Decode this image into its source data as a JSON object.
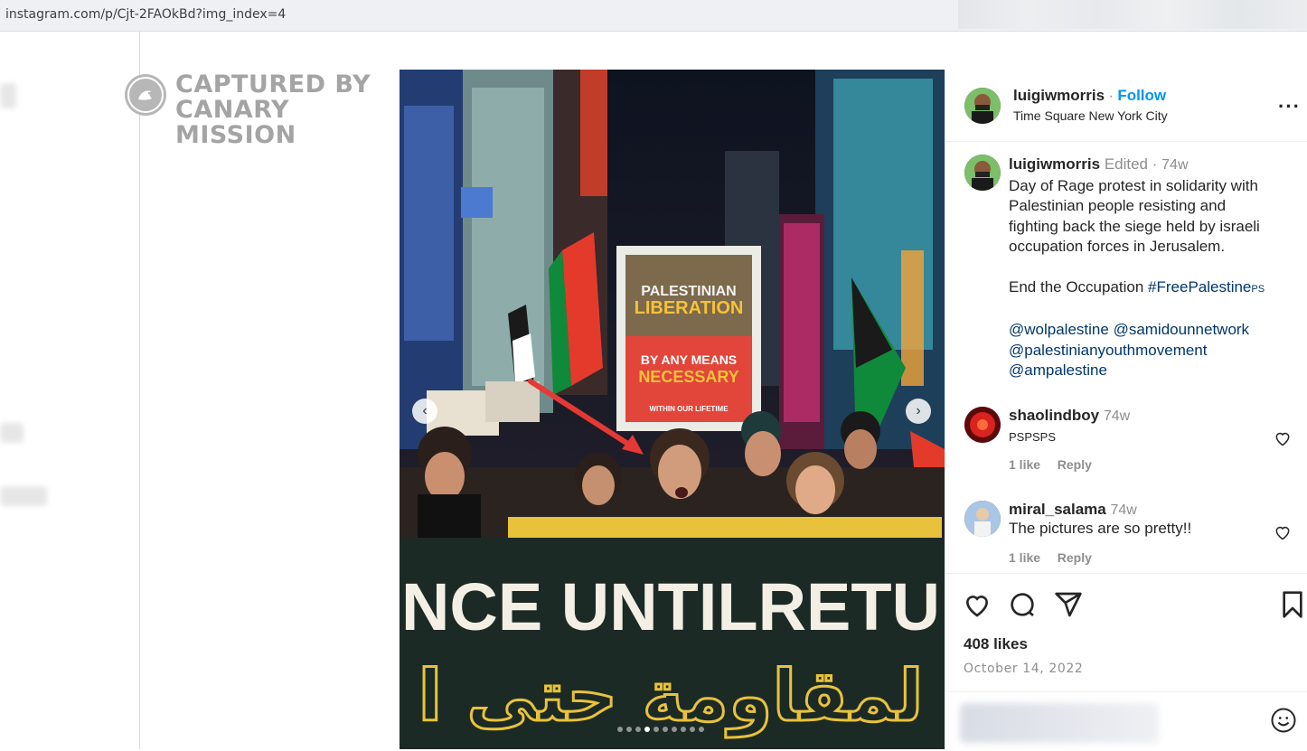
{
  "browser": {
    "url": "instagram.com/p/Cjt-2FAOkBd?img_index=4"
  },
  "watermark": {
    "line1": "CAPTURED BY",
    "line2": "CANARY MISSION"
  },
  "photo": {
    "sign_top": "PALESTINIAN",
    "sign_mid": "LIBERATION",
    "sign_bottom1": "BY ANY MEANS",
    "sign_bottom2": "NECESSARY",
    "sign_small": "WITHIN OUR LIFETIME",
    "banner_latin": "NCE UNTILRETU",
    "banner_arabic": "لمقاومة حتى ا",
    "carousel_prev_icon": "chevron-left-icon",
    "carousel_next_icon": "chevron-right-icon",
    "carousel_total": 10,
    "carousel_active_index": 4
  },
  "post": {
    "author": "luigiwmorris",
    "separator": "·",
    "follow_label": "Follow",
    "location": "Time Square New York City",
    "more_icon": "more-options-icon",
    "caption": {
      "author": "luigiwmorris",
      "edited": "Edited",
      "dot": "·",
      "age": "74w",
      "line1": "Day of Rage protest in solidarity with",
      "line2": "Palestinian people resisting and",
      "line3": "fighting back the siege held by israeli",
      "line4": "occupation forces in Jerusalem.",
      "line5_text": "End the Occupation ",
      "hashtag": "#FreePalestine",
      "flag_suffix": "PS",
      "mention1": "@wolpalestine",
      "mention2": "@samidounnetwork",
      "mention3": "@palestinianyouthmovement",
      "mention4": "@ampalestine"
    },
    "comments": [
      {
        "user": "shaolindboy",
        "age": "74w",
        "text": "PSPSPS",
        "likes": "1 like",
        "reply": "Reply"
      },
      {
        "user": "miral_salama",
        "age": "74w",
        "text": "The pictures are so pretty!!",
        "likes": "1 like",
        "reply": "Reply"
      }
    ],
    "likes": "408 likes",
    "date": "October 14, 2022"
  },
  "colors": {
    "link": "#00376b",
    "follow": "#0095f6",
    "arrow": "#e53935"
  }
}
